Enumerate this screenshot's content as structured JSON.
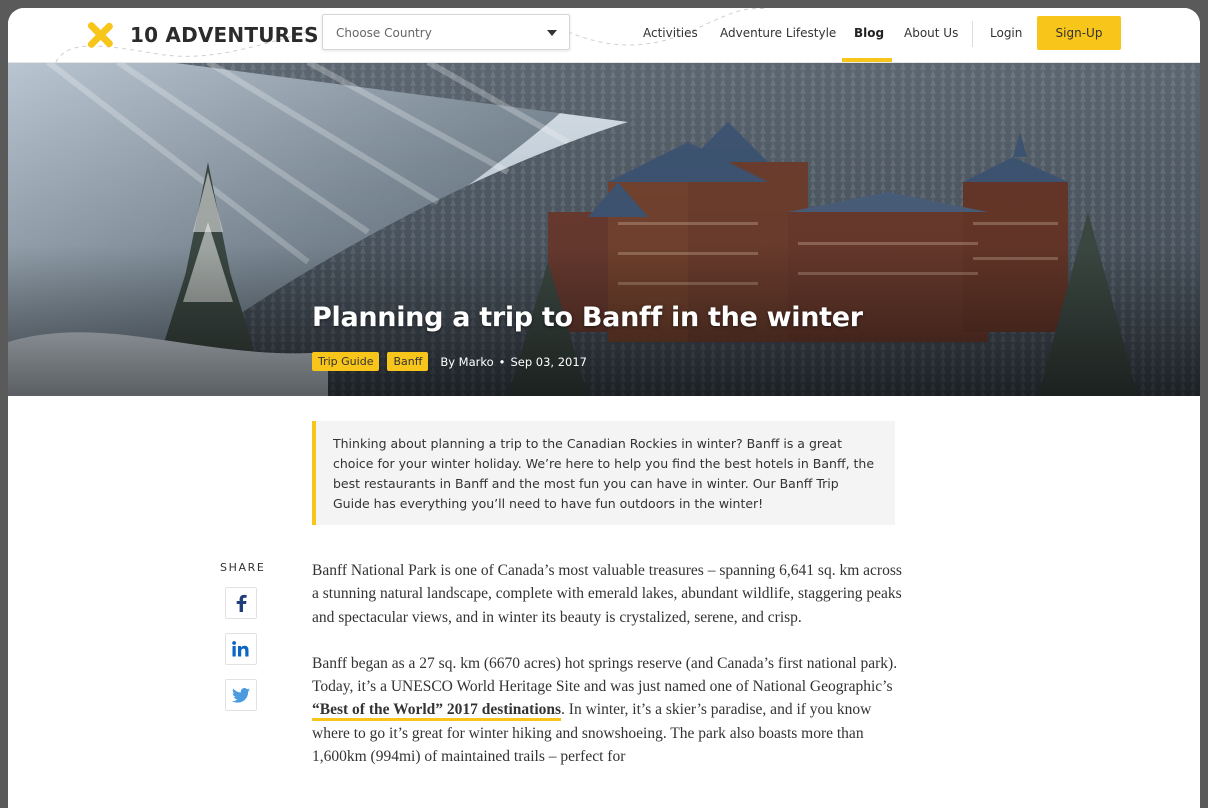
{
  "header": {
    "brand": "10 ADVENTURES",
    "country_select": {
      "value": "Choose Country"
    },
    "nav": [
      "Activities",
      "Adventure Lifestyle",
      "Blog",
      "About Us"
    ],
    "active_nav": "Blog",
    "login": "Login",
    "signup": "Sign-Up"
  },
  "hero": {
    "title": "Planning a trip to Banff in the winter",
    "tags": [
      "Trip Guide",
      "Banff"
    ],
    "author": "By Marko",
    "separator": "•",
    "date": "Sep 03, 2017"
  },
  "intro": "Thinking about planning a trip to the Canadian Rockies in winter? Banff is a great choice for your winter holiday. We’re here to help you find the best hotels in Banff, the best restaurants in Banff and the most fun you can have in winter. Our Banff Trip Guide has everything you’ll need to have fun outdoors in the winter!",
  "share": {
    "label": "SHARE"
  },
  "article": {
    "p1": "Banff National Park is one of Canada’s most valuable treasures – spanning 6,641 sq. km across a stunning natural landscape, complete with emerald lakes, abundant wildlife, staggering peaks and spectacular views, and in winter its beauty is crystalized, serene, and crisp.",
    "p2_before": "Banff began as a 27 sq. km (6670 acres) hot springs reserve (and Canada’s first national park). Today, it’s a UNESCO World Heritage Site and was just named one of National Geographic’s ",
    "p2_link": "“Best of the World” 2017 destinations",
    "p2_after": ". In winter, it’s a skier’s paradise, and if you know where to go it’s great for winter hiking and snowshoeing. The park also boasts more than 1,600km (994mi) of maintained trails – perfect for"
  },
  "colors": {
    "accent": "#f8c51b",
    "text": "#333333",
    "intro_bg": "#f4f4f4"
  }
}
